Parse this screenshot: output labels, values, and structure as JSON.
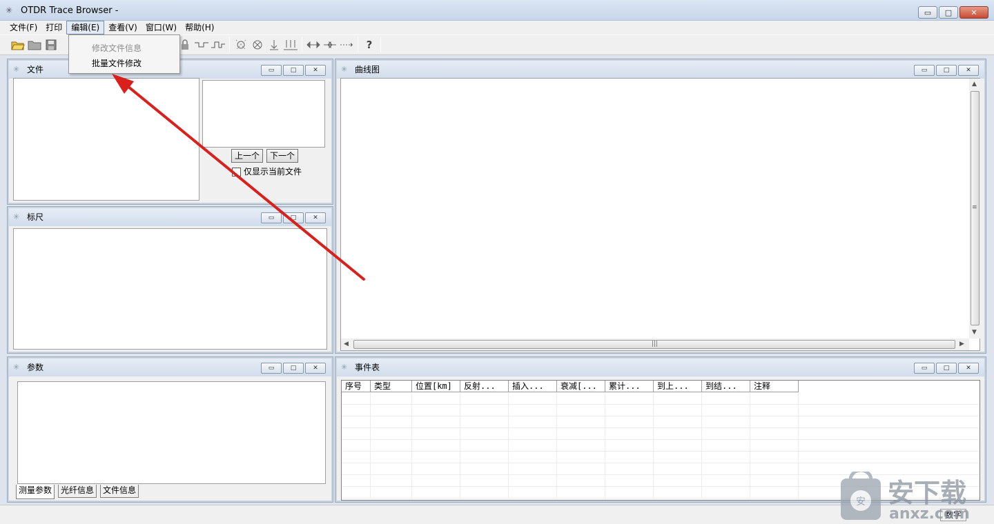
{
  "window": {
    "title": "OTDR Trace Browser -",
    "controls": {
      "minimize": "▭",
      "maximize": "□",
      "close": "✕"
    }
  },
  "menu": {
    "items": [
      "文件(F)",
      "打印",
      "编辑(E)",
      "查看(V)",
      "窗口(W)",
      "帮助(H)"
    ],
    "open_menu": "编辑(E)",
    "dropdown": [
      {
        "label": "修改文件信息",
        "disabled": true
      },
      {
        "label": "批量文件修改",
        "disabled": false
      }
    ]
  },
  "toolbar": {
    "icons": [
      "open-folder-icon",
      "folder-icon",
      "save-icon",
      "lock-icon",
      "trace-step-icon",
      "trace-step-alt-icon",
      "event-marker-icon",
      "event-remove-icon",
      "marker-down-icon",
      "marker-multi-down-icon",
      "zoom-out-h-icon",
      "zoom-in-h-icon",
      "fit-h-icon",
      "help-icon"
    ],
    "help_glyph": "?"
  },
  "panels": {
    "file": {
      "title": "文件",
      "prev_button": "上一个",
      "next_button": "下一个",
      "only_current_label": "仅显示当前文件",
      "only_current_checked": false
    },
    "ruler": {
      "title": "标尺"
    },
    "params": {
      "title": "参数",
      "tabs": [
        "测量参数",
        "光纤信息",
        "文件信息"
      ],
      "active_tab": "测量参数"
    },
    "curve": {
      "title": "曲线图"
    },
    "events": {
      "title": "事件表",
      "columns": [
        "序号",
        "类型",
        "位置[km]",
        "反射...",
        "插入...",
        "衰减[...",
        "累计...",
        "到上...",
        "到结...",
        "注释"
      ],
      "rows": []
    }
  },
  "status": {
    "mode": "数字"
  },
  "watermark": {
    "text": "安下载",
    "domain": "anxz.com",
    "badge": "安"
  },
  "colors": {
    "annotation_arrow": "#d9201c",
    "title_bar": "#c7d6ea",
    "menu_highlight": "#e3e9f2"
  }
}
